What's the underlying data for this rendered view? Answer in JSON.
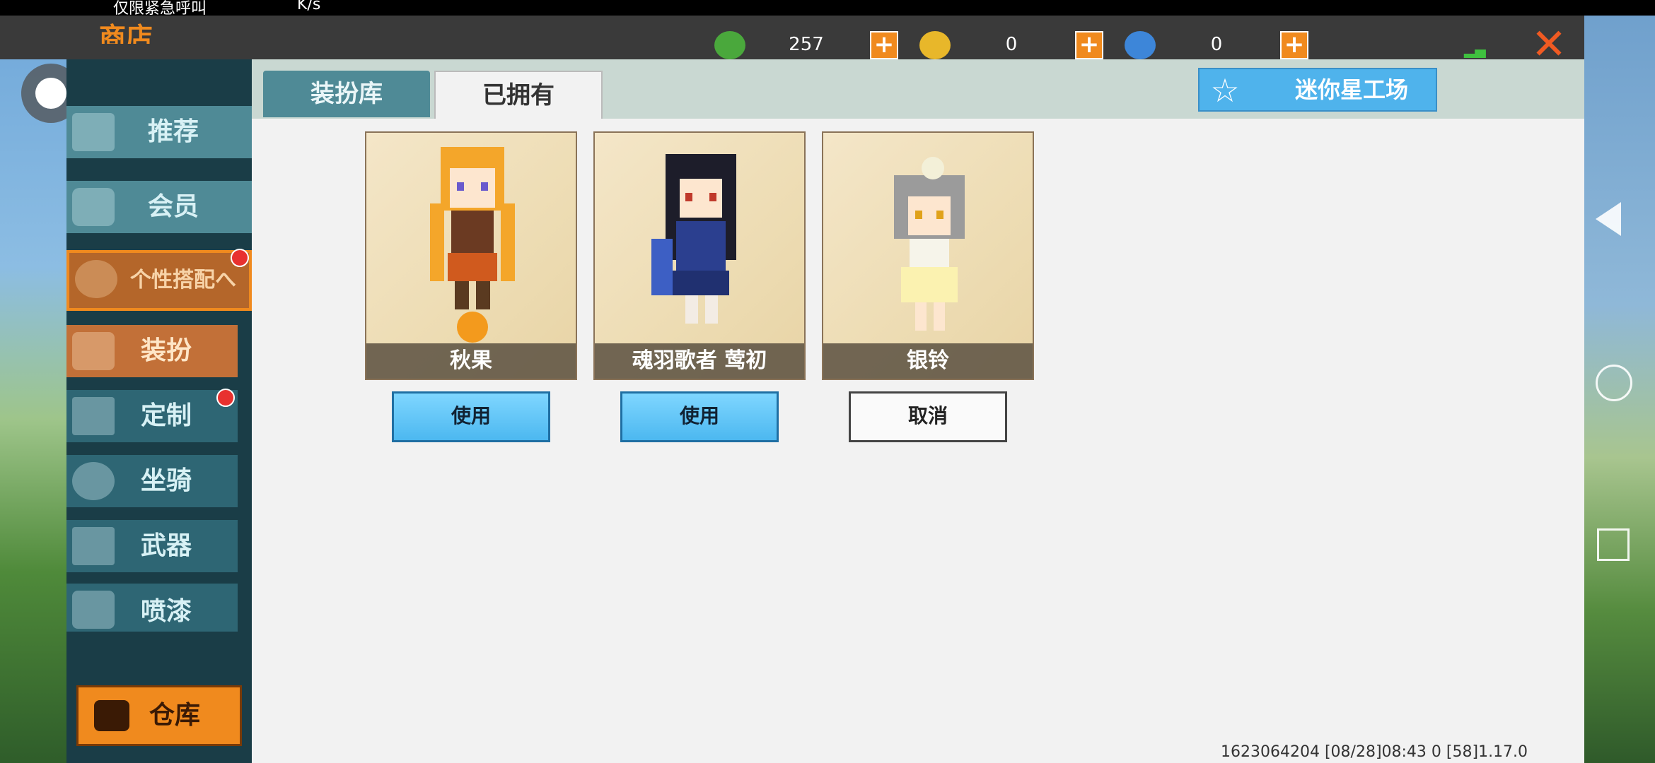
{
  "status_bar": {
    "left_text": "仅限紧急呼叫",
    "speed": "K/s"
  },
  "topbar": {
    "title": "商店",
    "currencies": [
      {
        "icon": "mini-bean-icon",
        "value": "257"
      },
      {
        "icon": "mini-coin-icon",
        "value": "0"
      },
      {
        "icon": "star-coin-icon",
        "value": "0"
      }
    ],
    "plus_label": "+",
    "close_label": "✕"
  },
  "sidebar": {
    "items": [
      {
        "label": "推荐",
        "icon": "thumb-icon"
      },
      {
        "label": "会员",
        "icon": "member-icon"
      },
      {
        "label": "个性搭配へ",
        "icon": "trophy-icon"
      },
      {
        "label": "装扮",
        "icon": "shirt-icon"
      },
      {
        "label": "定制",
        "icon": "pencil-icon"
      },
      {
        "label": "坐骑",
        "icon": "mount-icon"
      },
      {
        "label": "武器",
        "icon": "gun-icon"
      },
      {
        "label": "喷漆",
        "icon": "spray-icon"
      }
    ],
    "warehouse_label": "仓库"
  },
  "tabs": {
    "library": "装扮库",
    "owned": "已拥有"
  },
  "studio_label": "迷你星工场",
  "cards": [
    {
      "name": "秋果",
      "button": "使用"
    },
    {
      "name": "魂羽歌者 莺初",
      "button": "使用"
    },
    {
      "name": "银铃",
      "button": "取消"
    }
  ],
  "version_text": "1623064204  [08/28]08:43 0 [58]1.17.0"
}
